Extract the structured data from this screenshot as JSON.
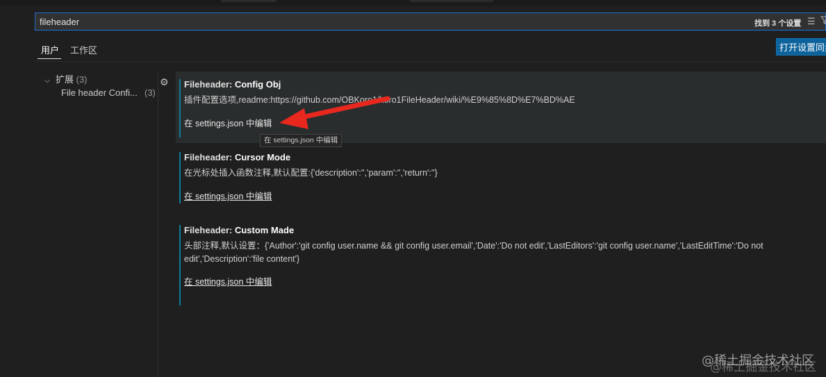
{
  "search": {
    "value": "fileheader",
    "result_count": "找到 3 个设置",
    "clear_filter_icon": "clear-filter-icon",
    "filter_icon": "filter-icon"
  },
  "tabs": [
    {
      "label": "用户",
      "active": true
    },
    {
      "label": "工作区",
      "active": false
    }
  ],
  "open_settings_button": "打开设置同步",
  "toc": {
    "group_label": "扩展",
    "group_count": "(3)",
    "item_label": "File header Confi...",
    "item_count": "(3)"
  },
  "settings": [
    {
      "category": "Fileheader: ",
      "name": "Config Obj",
      "description": "插件配置选项,readme:https://github.com/OBKoro1/koro1FileHeader/wiki/%E9%85%8D%E7%BD%AE",
      "link": "在 settings.json 中编辑"
    },
    {
      "category": "Fileheader: ",
      "name": "Cursor Mode",
      "description": "在光标处插入函数注释,默认配置:{'description':'','param':'','return':''}",
      "link": "在 settings.json 中编辑"
    },
    {
      "category": "Fileheader: ",
      "name": "Custom Made",
      "description": "头部注释,默认设置：{'Author':'git config user.name && git config user.email','Date':'Do not edit','LastEditors':'git config user.name','LastEditTime':'Do not edit','Description':'file content'}",
      "link": "在 settings.json 中编辑"
    }
  ],
  "tooltip": "在 settings.json 中编辑",
  "watermark": "@稀土掘金技术社区",
  "colors": {
    "accent": "#0e639c",
    "focus_border": "#1f6fd0",
    "annotation_arrow": "#e8281e"
  }
}
